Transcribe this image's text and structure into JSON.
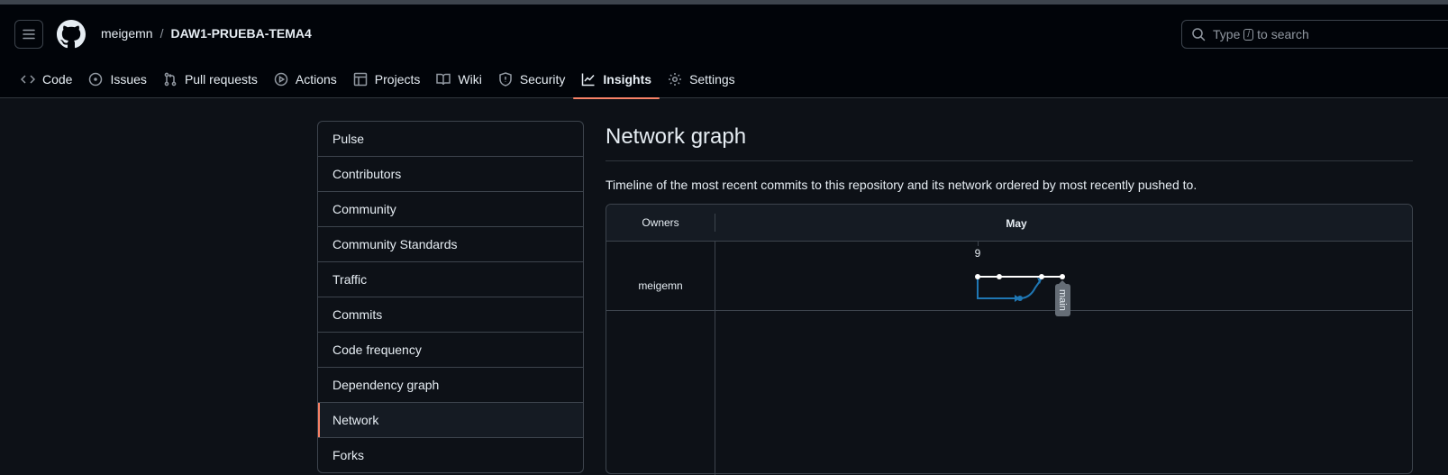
{
  "header": {
    "owner": "meigemn",
    "separator": "/",
    "repo": "DAW1-PRUEBA-TEMA4",
    "search_before": "Type",
    "search_key": "/",
    "search_after": "to search"
  },
  "tabs": [
    {
      "label": "Code",
      "icon": "code-icon"
    },
    {
      "label": "Issues",
      "icon": "issue-opened-icon"
    },
    {
      "label": "Pull requests",
      "icon": "git-pull-request-icon"
    },
    {
      "label": "Actions",
      "icon": "play-icon"
    },
    {
      "label": "Projects",
      "icon": "table-icon"
    },
    {
      "label": "Wiki",
      "icon": "book-icon"
    },
    {
      "label": "Security",
      "icon": "shield-icon"
    },
    {
      "label": "Insights",
      "icon": "graph-icon",
      "active": true
    },
    {
      "label": "Settings",
      "icon": "gear-icon"
    }
  ],
  "sidebar": {
    "items": [
      {
        "label": "Pulse"
      },
      {
        "label": "Contributors"
      },
      {
        "label": "Community"
      },
      {
        "label": "Community Standards"
      },
      {
        "label": "Traffic"
      },
      {
        "label": "Commits"
      },
      {
        "label": "Code frequency"
      },
      {
        "label": "Dependency graph"
      },
      {
        "label": "Network",
        "selected": true
      },
      {
        "label": "Forks"
      }
    ]
  },
  "main": {
    "title": "Network graph",
    "description": "Timeline of the most recent commits to this repository and its network ordered by most recently pushed to."
  },
  "graph": {
    "owners_header": "Owners",
    "month": "May",
    "day": "9",
    "owner": "meigemn",
    "branch_label": "main",
    "colors": {
      "main_line": "#ffffff",
      "branch_line": "#1f77b4",
      "label_bg": "#656d76",
      "accent": "#f78166"
    }
  }
}
